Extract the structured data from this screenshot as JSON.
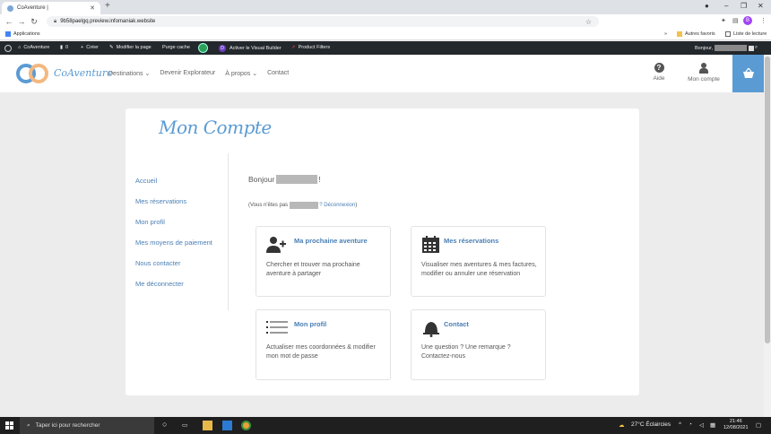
{
  "browser": {
    "tab_title": "CoAventure |",
    "url": "9b58paelgq.preview.infomaniak.website",
    "bookmarks": {
      "apps": "Applications",
      "autres": "Autres favoris",
      "lecture": "Liste de lecture"
    },
    "profile_initial": "B"
  },
  "wpbar": {
    "site": "CoAventure",
    "comments": "0",
    "create": "Créer",
    "edit": "Modifier la page",
    "purge": "Purge cache",
    "visual": "Activer le Visual Builder",
    "filters": "Product Filters",
    "hello": "Bonjour,"
  },
  "header": {
    "logo": "CoAventure",
    "nav": [
      "Destinations",
      "Devenir Explorateur",
      "À propos",
      "Contact"
    ],
    "aide": "Aide",
    "compte": "Mon compte"
  },
  "page": {
    "title": "Mon Compte",
    "sidemenu": [
      "Accueil",
      "Mes réservations",
      "Mon profil",
      "Mes moyens de paiement",
      "Nous contacter",
      "Me déconnecter"
    ],
    "greeting_prefix": "Bonjour",
    "greeting_suffix": "!",
    "notyou_prefix": "(Vous n'êtes pas",
    "notyou_link": "? Déconnexion",
    "notyou_suffix": ")",
    "tiles": [
      {
        "title": "Ma prochaine aventure",
        "desc": "Chercher et trouver ma prochaine aventure à partager",
        "icon": "add-user-icon"
      },
      {
        "title": "Mes réservations",
        "desc": "Visualiser mes aventures & mes factures, modifier ou annuler une réservation",
        "icon": "calendar-icon"
      },
      {
        "title": "Mon profil",
        "desc": "Actualiser mes coordonnées & modifier mon mot de passe",
        "icon": "list-icon"
      },
      {
        "title": "Contact",
        "desc": "Une question ? Une remarque ? Contactez-nous",
        "icon": "bell-icon"
      }
    ]
  },
  "taskbar": {
    "search": "Taper ici pour rechercher",
    "weather": "27°C  Éclaircies",
    "time": "21:46",
    "date": "12/08/2021"
  }
}
